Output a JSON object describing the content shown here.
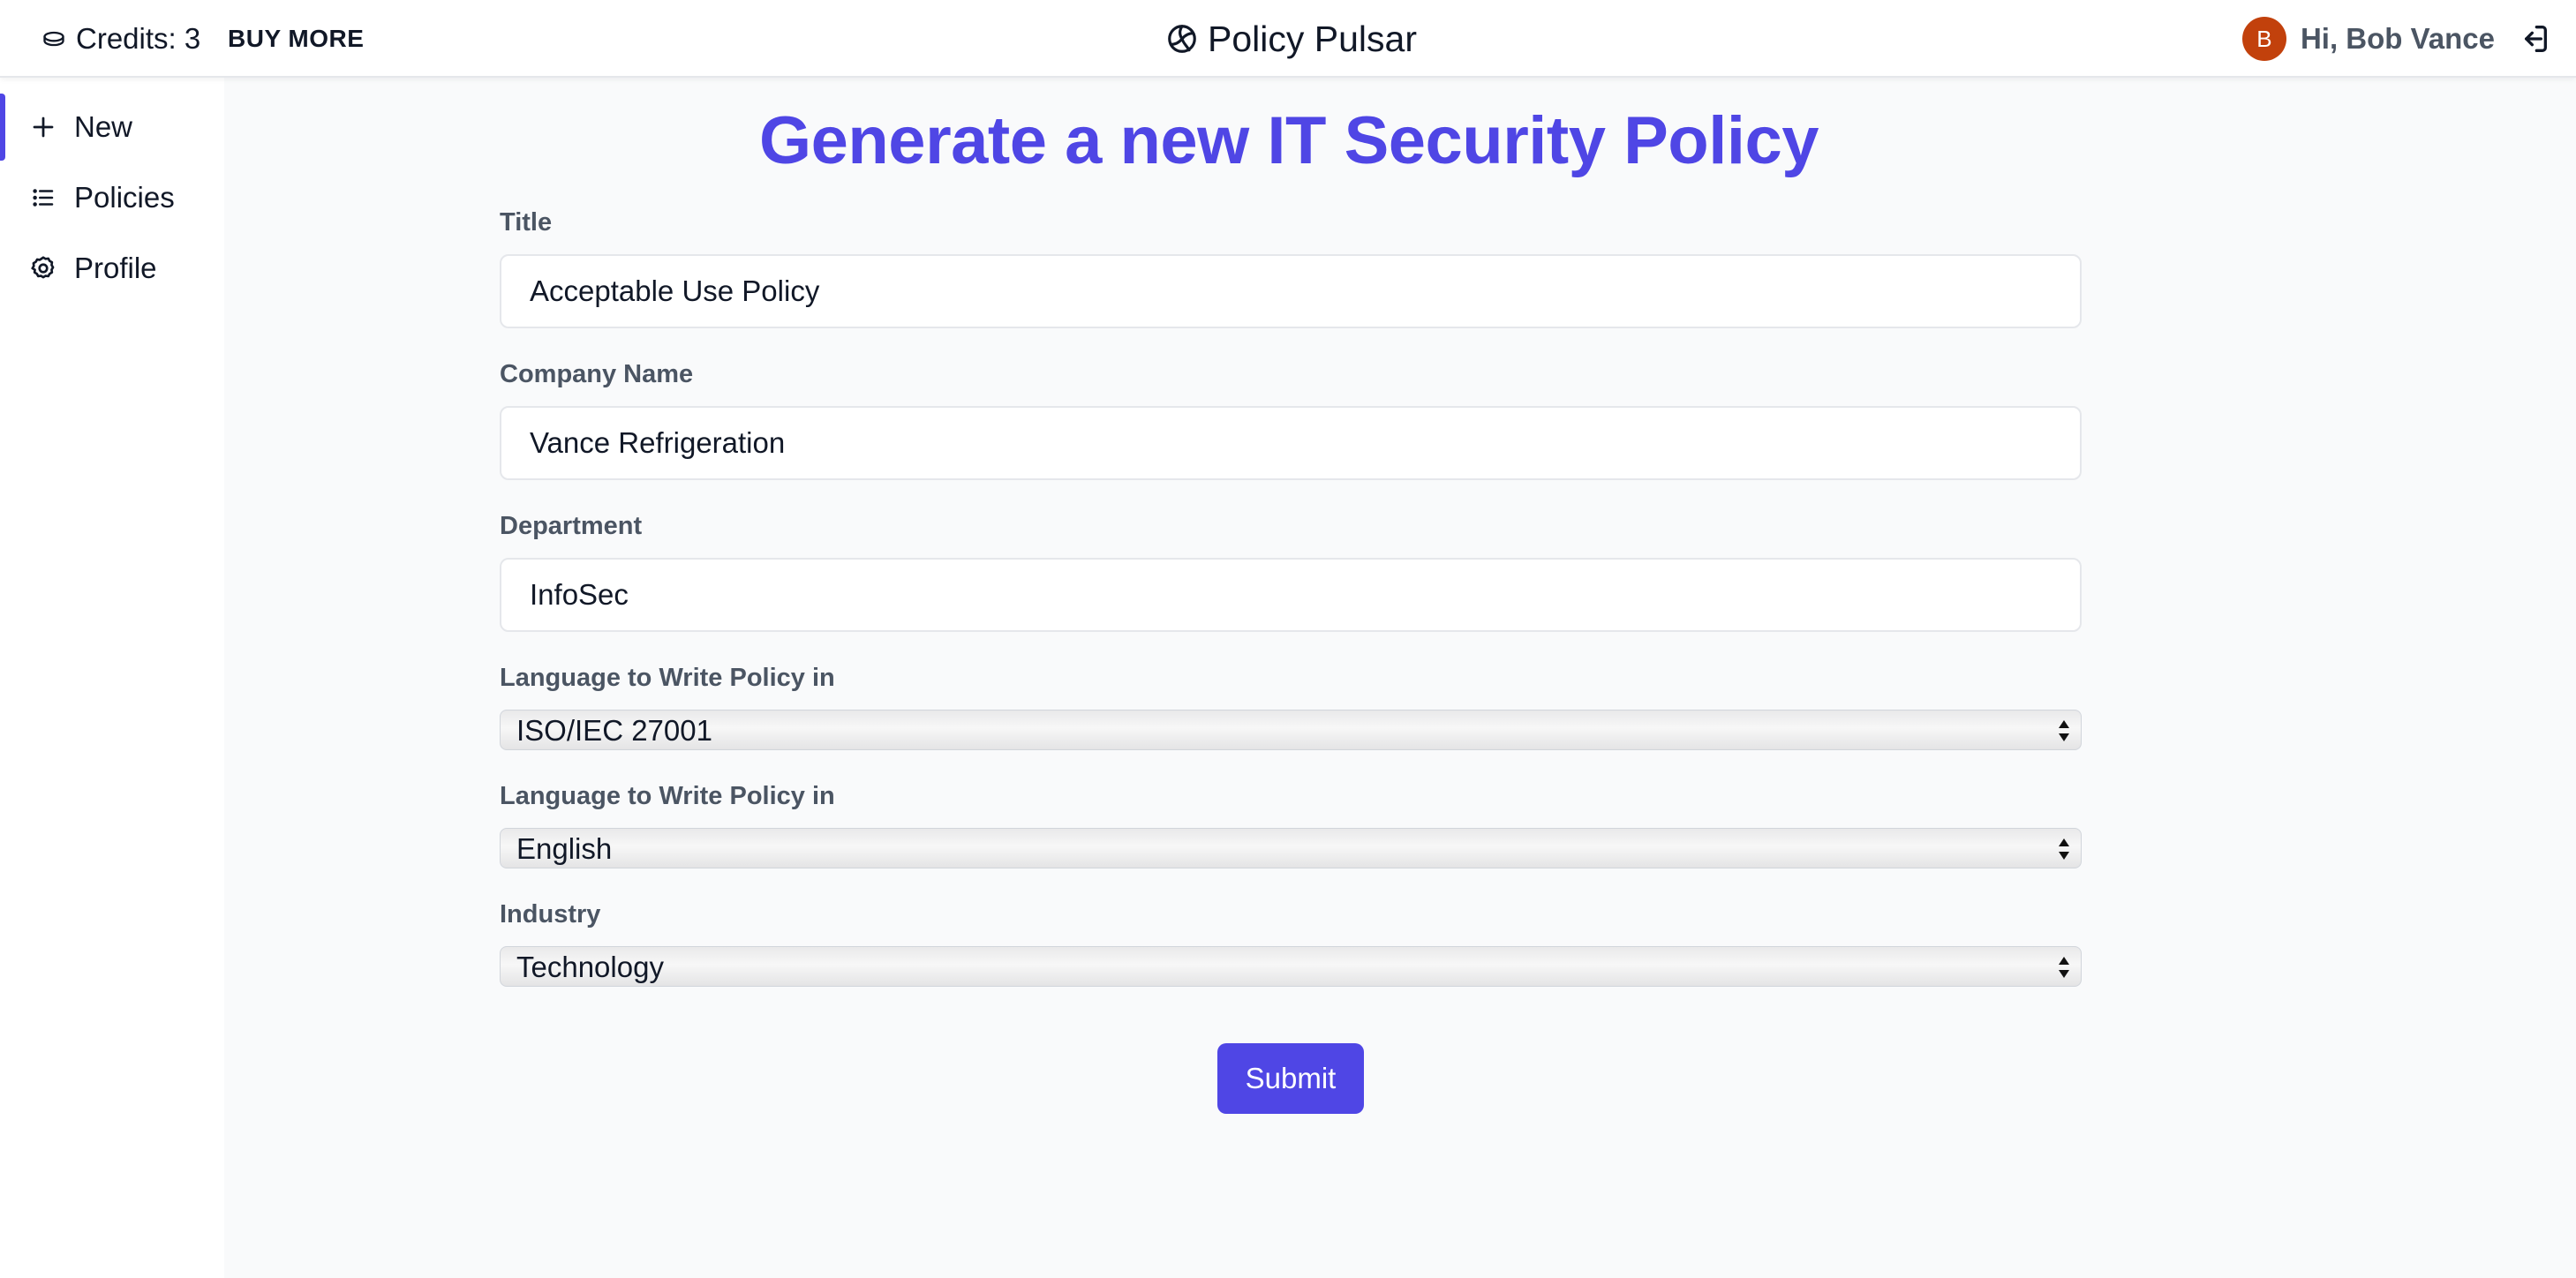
{
  "topbar": {
    "credits_label": "Credits: 3",
    "buy_more_label": "BUY MORE",
    "brand_name": "Policy Pulsar",
    "avatar_initial": "B",
    "greeting": "Hi, Bob Vance"
  },
  "sidebar": {
    "items": [
      {
        "label": "New",
        "icon": "plus-icon",
        "active": true
      },
      {
        "label": "Policies",
        "icon": "list-icon",
        "active": false
      },
      {
        "label": "Profile",
        "icon": "gear-icon",
        "active": false
      }
    ]
  },
  "main": {
    "title": "Generate a new IT Security Policy",
    "form": {
      "title_label": "Title",
      "title_value": "Acceptable Use Policy",
      "company_label": "Company Name",
      "company_value": "Vance Refrigeration",
      "department_label": "Department",
      "department_value": "InfoSec",
      "framework_label": "Language to Write Policy in",
      "framework_value": "ISO/IEC 27001",
      "language_label": "Language to Write Policy in",
      "language_value": "English",
      "industry_label": "Industry",
      "industry_value": "Technology",
      "submit_label": "Submit"
    }
  },
  "colors": {
    "accent": "#4f46e5",
    "avatar_bg": "#c2410c",
    "page_bg": "#f9fafb",
    "label": "#4b5563"
  }
}
